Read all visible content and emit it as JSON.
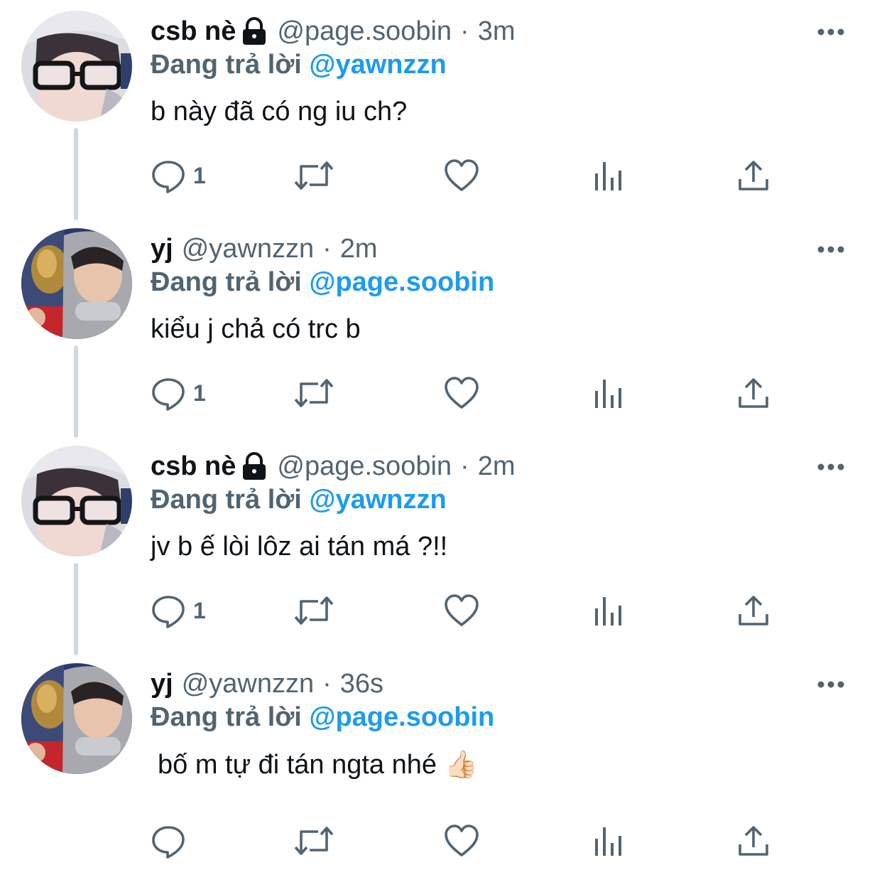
{
  "tweets": [
    {
      "display_name": "csb nè",
      "locked": true,
      "handle": "@page.soobin",
      "time": "3m",
      "reply_prefix": "Đang trả lời",
      "reply_to": "@yawnzzn",
      "text": "b này đã có ng iu ch?",
      "reply_count": "1",
      "avatar": "hooded-glasses-avatar"
    },
    {
      "display_name": "yj",
      "locked": false,
      "handle": "@yawnzzn",
      "time": "2m",
      "reply_prefix": "Đang trả lời",
      "reply_to": "@page.soobin",
      "text": "kiểu j chả có trc b",
      "reply_count": "1",
      "avatar": "gray-hoodie-avatar"
    },
    {
      "display_name": "csb nè",
      "locked": true,
      "handle": "@page.soobin",
      "time": "2m",
      "reply_prefix": "Đang trả lời",
      "reply_to": "@yawnzzn",
      "text": "jv b ế lòi lôz ai tán má ?!!",
      "reply_count": "1",
      "avatar": "hooded-glasses-avatar"
    },
    {
      "display_name": "yj",
      "locked": false,
      "handle": "@yawnzzn",
      "time": "36s",
      "reply_prefix": "Đang trả lời",
      "reply_to": "@page.soobin",
      "text": "bố m tự đi tán ngta nhé 👍🏻",
      "reply_count": "",
      "avatar": "gray-hoodie-avatar"
    }
  ],
  "separator": "·",
  "icons": {
    "lock": "lock-icon",
    "more": "more-horizontal-icon",
    "reply": "reply-bubble-icon",
    "retweet": "retweet-icon",
    "like": "heart-icon",
    "views": "views-bar-chart-icon",
    "share": "share-upload-icon"
  },
  "colors": {
    "text": "#0f1419",
    "secondary": "#536471",
    "link": "#1d9bf0",
    "thread_line": "#cfd9de"
  }
}
